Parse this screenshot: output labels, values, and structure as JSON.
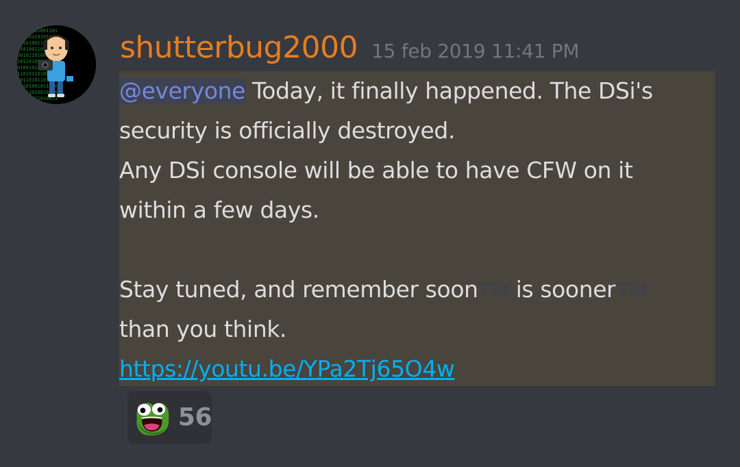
{
  "message": {
    "author": "shutterbug2000",
    "timestamp": "15 feb 2019 11:41 PM",
    "mention": "@everyone",
    "line1_rest": " Today, it finally happened. The DSi's",
    "line2": "security is officially destroyed.",
    "line3": "Any DSi console will be able to have CFW on it",
    "line4": "within a few days.",
    "line5_a": "Stay tuned, and remember soon",
    "tm1": "TM",
    "line5_b": " is sooner",
    "tm2": "TM",
    "line6": "than you think.",
    "link": "https://youtu.be/YPa2Tj65O4w"
  },
  "reaction": {
    "emoji_icon": "poggers-frog-icon",
    "count": "56"
  },
  "colors": {
    "background": "#36393f",
    "username": "#e67e22",
    "timestamp": "#72767d",
    "mention_highlight": "#49443c",
    "mention_text": "#7289da",
    "link": "#00b0f4"
  }
}
